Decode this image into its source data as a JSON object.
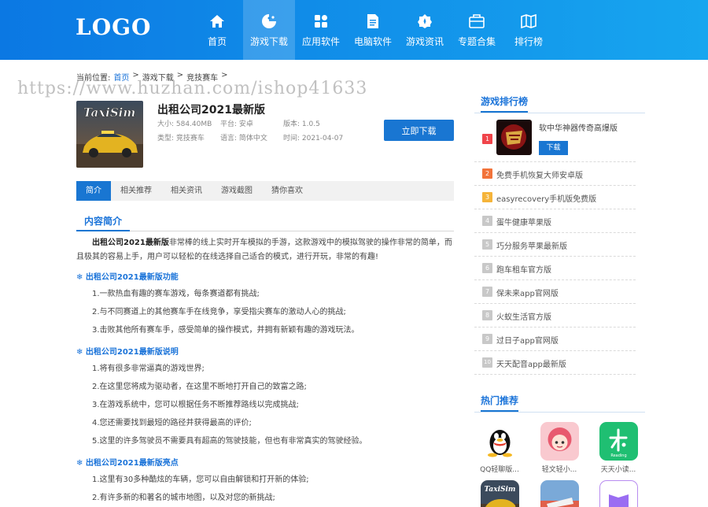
{
  "header": {
    "logo": "LOGO",
    "nav": [
      {
        "label": "首页",
        "icon": "home-icon"
      },
      {
        "label": "游戏下载",
        "icon": "pacman-icon"
      },
      {
        "label": "应用软件",
        "icon": "apps-grid-icon"
      },
      {
        "label": "电脑软件",
        "icon": "document-icon"
      },
      {
        "label": "游戏资讯",
        "icon": "badge-icon"
      },
      {
        "label": "专题合集",
        "icon": "folder-icon"
      },
      {
        "label": "排行榜",
        "icon": "map-icon"
      }
    ],
    "active_nav": "游戏下载",
    "colors": {
      "header_start": "#0b78e3",
      "header_end": "#17a6ef"
    }
  },
  "breadcrumb": {
    "prefix": "当前位置:",
    "home": "首页",
    "sep": ">",
    "level1": "游戏下载",
    "level2": "竞技赛车"
  },
  "watermark": "https://www.huzhan.com/ishop41633",
  "game": {
    "thumb_text": "TaxiSim",
    "title": "出租公司2021最新版",
    "size": "大小: 584.40MB",
    "platform": "平台: 安卓",
    "version": "版本: 1.0.5",
    "type": "类型: 竞技赛车",
    "language": "语言: 简体中文",
    "date": "时间: 2021-04-07",
    "download_label": "立即下载"
  },
  "tabs": [
    "简介",
    "相关推荐",
    "相关资讯",
    "游戏截图",
    "猜你喜欢"
  ],
  "section_title": "内容简介",
  "content": {
    "intro_bold": "出租公司2021最新版",
    "intro_rest": "非常棒的线上实时开车模拟的手游，这款游戏中的模拟驾驶的操作非常的简单，而且极其的容易上手，用户可以轻松的在线选择自己适合的模式，进行开玩，非常的有趣!",
    "head1": "❄ 出租公司2021最新版功能",
    "list1": [
      "1.一款热血有趣的赛车游戏，每条赛道都有挑战;",
      "2.与不同赛道上的其他赛车手在线竞争，享受指尖赛车的激动人心的挑战;",
      "3.击败其他所有赛车手，感受简单的操作模式，并拥有新颖有趣的游戏玩法。"
    ],
    "head2": "❄ 出租公司2021最新版说明",
    "list2": [
      "1.将有很多非常逼真的游戏世界;",
      "2.在这里您将成为驱动者，在这里不断地打开自己的致富之路;",
      "3.在游戏系统中，您可以根据任务不断推荐路线以完成挑战;",
      "4.您还需要找到最短的路径并获得最高的评价;",
      "5.这里的许多驾驶员不需要具有超高的驾驶技能，但也有非常真实的驾驶经验。"
    ],
    "head3": "❄ 出租公司2021最新版亮点",
    "list3": [
      "1.这里有30多种酷炫的车辆，您可以自由解锁和打开新的体验;",
      "2.有许多新的和著名的城市地图，以及对您的新挑战;"
    ]
  },
  "ranking": {
    "title": "游戏排行榜",
    "top": {
      "num": "1",
      "label": "软中华神器传奇高爆版",
      "download": "下载"
    },
    "items": [
      {
        "num": "2",
        "label": "免费手机恢复大师安卓版"
      },
      {
        "num": "3",
        "label": "easyrecovery手机版免费版"
      },
      {
        "num": "4",
        "label": "蛋牛健康苹果版"
      },
      {
        "num": "5",
        "label": "巧分服务苹果最新版"
      },
      {
        "num": "6",
        "label": "跑车租车官方版"
      },
      {
        "num": "7",
        "label": "保未来app官网版"
      },
      {
        "num": "8",
        "label": "火蚁生活官方版"
      },
      {
        "num": "9",
        "label": "过日子app官网版"
      },
      {
        "num": "10",
        "label": "天天配音app最新版"
      }
    ],
    "colors": {
      "r1": "#f0444a",
      "r2": "#f2733a",
      "r3": "#f5b43a",
      "rest": "#c8c8c8"
    }
  },
  "hot": {
    "title": "热门推荐",
    "items": [
      {
        "name": "QQ轻聊版..."
      },
      {
        "name": "轻文轻小..."
      },
      {
        "name": "天天小读..."
      }
    ]
  }
}
